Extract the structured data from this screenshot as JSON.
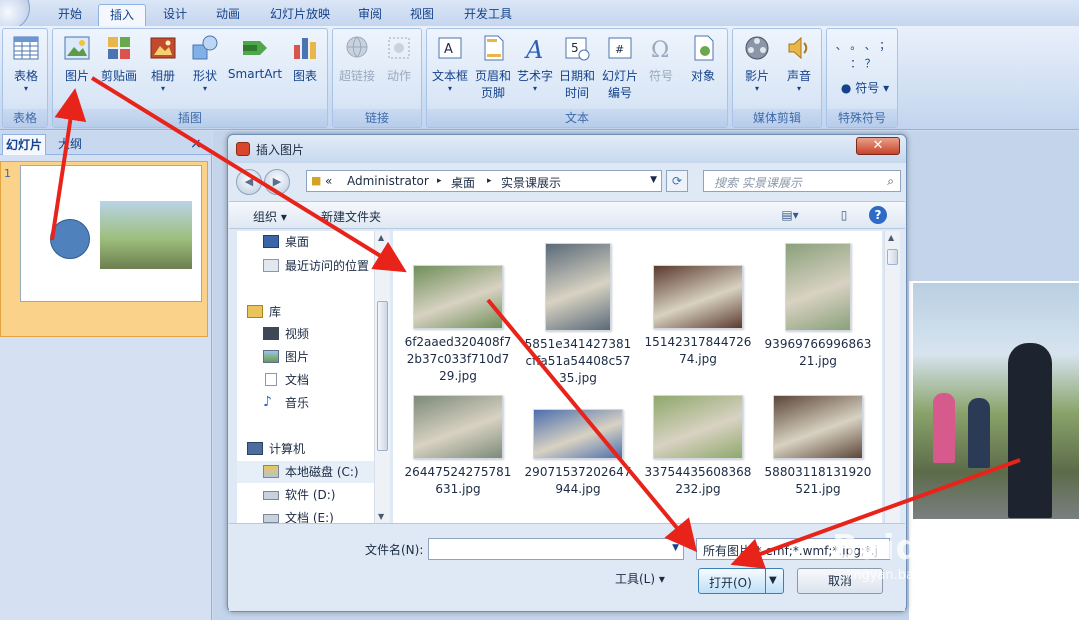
{
  "ribbon": {
    "tabs": [
      {
        "label": "开始"
      },
      {
        "label": "插入"
      },
      {
        "label": "设计"
      },
      {
        "label": "动画"
      },
      {
        "label": "幻灯片放映"
      },
      {
        "label": "审阅"
      },
      {
        "label": "视图"
      },
      {
        "label": "开发工具"
      }
    ],
    "groups": {
      "table": {
        "label": "表格",
        "buttons": [
          "表格"
        ]
      },
      "illustrations": {
        "label": "插图",
        "buttons": [
          "图片",
          "剪贴画",
          "相册",
          "形状",
          "SmartArt",
          "图表"
        ]
      },
      "links": {
        "label": "链接",
        "buttons": [
          "超链接",
          "动作"
        ]
      },
      "text": {
        "label": "文本",
        "buttons": [
          "文本框",
          "页眉和",
          "页脚",
          "艺术字",
          "日期和",
          "时间",
          "幻灯片",
          "编号",
          "符号",
          "对象"
        ]
      },
      "media": {
        "label": "媒体剪辑",
        "buttons": [
          "影片",
          "声音"
        ]
      },
      "special": {
        "label": "特殊符号",
        "button": "符号",
        "symbols": "、 。 、 ； ： ？"
      }
    }
  },
  "left_panel": {
    "tabs": [
      "幻灯片",
      "大纲"
    ],
    "close": "×",
    "slide_number": "1"
  },
  "dialog": {
    "title": "插入图片",
    "close": "✕",
    "breadcrumb": [
      "«",
      "Administrator",
      "▸",
      "桌面",
      "▸",
      "实景课展示"
    ],
    "search_placeholder": "搜索 实景课展示",
    "toolbar": {
      "organize": "组织 ▾",
      "new_folder": "新建文件夹"
    },
    "nav": [
      {
        "label": "桌面",
        "icon": "desktop-icon"
      },
      {
        "label": "最近访问的位置",
        "icon": "recent-icon"
      },
      {
        "label": "库",
        "icon": "library-icon"
      },
      {
        "label": "视频",
        "icon": "video-icon"
      },
      {
        "label": "图片",
        "icon": "picture-icon"
      },
      {
        "label": "文档",
        "icon": "document-icon"
      },
      {
        "label": "音乐",
        "icon": "music-icon"
      },
      {
        "label": "计算机",
        "icon": "computer-icon"
      },
      {
        "label": "本地磁盘 (C:)",
        "icon": "drive-icon"
      },
      {
        "label": "软件 (D:)",
        "icon": "drive-icon"
      },
      {
        "label": "文档 (E:)",
        "icon": "drive-icon"
      }
    ],
    "files": [
      {
        "name": "6f2aaed320408f72b37c033f710d729.jpg",
        "color": "#6f8f5a"
      },
      {
        "name": "5851e341427381cffa51a54408c5735.jpg",
        "color": "#5a6a78"
      },
      {
        "name": "1514231784472674.jpg",
        "color": "#5b3a2e"
      },
      {
        "name": "9396976699686321.jpg",
        "color": "#8aa07a"
      },
      {
        "name": "26447524275781631.jpg",
        "color": "#7d8a7a"
      },
      {
        "name": "29071537202647944.jpg",
        "color": "#4d6fae"
      },
      {
        "name": "33754435608368232.jpg",
        "color": "#8fa86c"
      },
      {
        "name": "58803118131920521.jpg",
        "color": "#5c4638"
      }
    ],
    "bottom": {
      "filename_label": "文件名(N):",
      "filename_value": "",
      "filetype": "所有图片(*.emf;*.wmf;*.jpg;*.j",
      "tools": "工具(L)  ▾",
      "open": "打开(O)",
      "cancel": "取消"
    }
  },
  "watermark": {
    "text": "Baidu经验",
    "sub": "jingyan.baidu.com"
  },
  "colors": {
    "annotation_arrow": "#e8231a",
    "accent": "#15428b"
  }
}
